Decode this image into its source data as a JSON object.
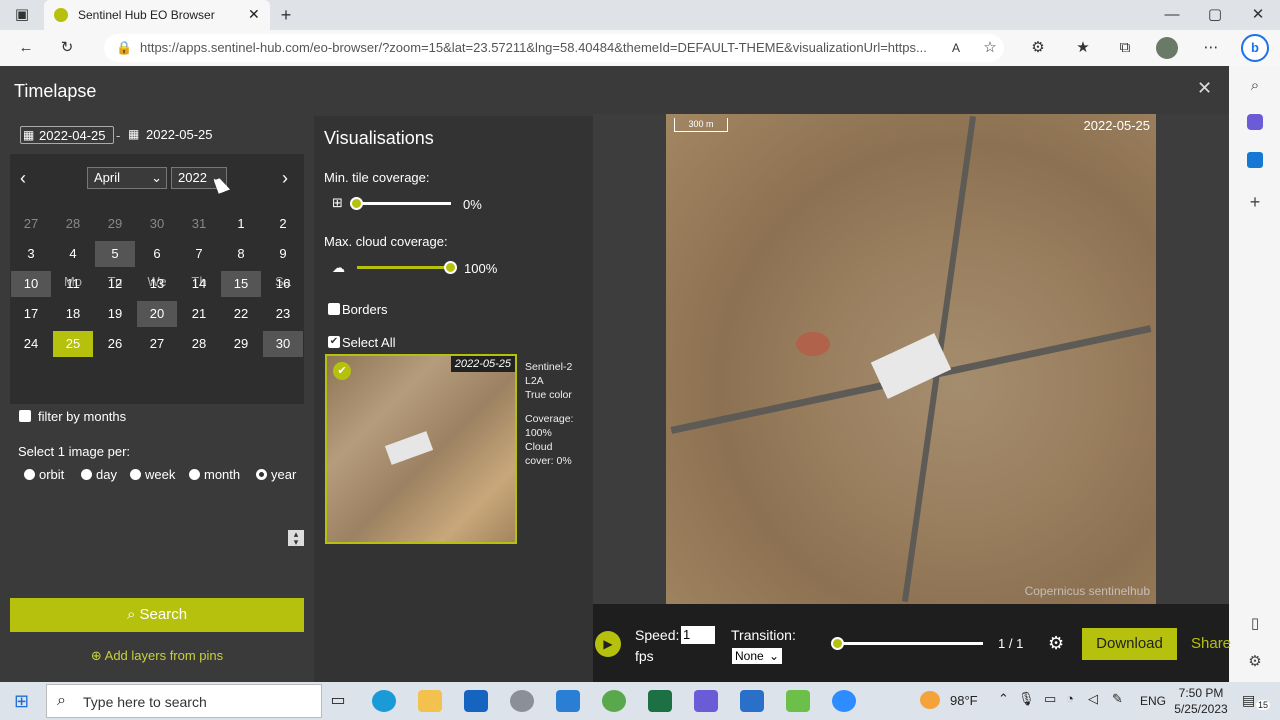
{
  "browser": {
    "tab_title": "Sentinel Hub EO Browser",
    "url": "https://apps.sentinel-hub.com/eo-browser/?zoom=15&lat=23.57211&lng=58.40484&themeId=DEFAULT-THEME&visualizationUrl=https..."
  },
  "panel": {
    "title": "Timelapse",
    "date_from": "2022-04-25",
    "date_sep": "-",
    "date_to": "2022-05-25"
  },
  "calendar": {
    "month": "April",
    "year": "2022",
    "weekdays": [
      "Su",
      "Mo",
      "Tu",
      "We",
      "Th",
      "Fr",
      "Sa"
    ],
    "rows": [
      [
        "27",
        "28",
        "29",
        "30",
        "31",
        "1",
        "2"
      ],
      [
        "3",
        "4",
        "5",
        "6",
        "7",
        "8",
        "9"
      ],
      [
        "10",
        "11",
        "12",
        "13",
        "14",
        "15",
        "16"
      ],
      [
        "17",
        "18",
        "19",
        "20",
        "21",
        "22",
        "23"
      ],
      [
        "24",
        "25",
        "26",
        "27",
        "28",
        "29",
        "30"
      ]
    ]
  },
  "filters": {
    "filter_by_months": "filter by months",
    "select_per_label": "Select 1 image per:",
    "options": [
      "orbit",
      "day",
      "week",
      "month",
      "year"
    ],
    "selected": "year"
  },
  "search_label": "Search",
  "add_layers_label": "Add layers from pins",
  "visualisations": {
    "title": "Visualisations",
    "min_tile_label": "Min. tile coverage:",
    "min_tile_value": "0%",
    "max_cloud_label": "Max. cloud coverage:",
    "max_cloud_value": "100%",
    "borders_label": "Borders",
    "select_all_label": "Select All",
    "thumb": {
      "date": "2022-05-25",
      "info": [
        "Sentinel-2",
        "L2A",
        "True color",
        "",
        "Coverage:",
        "100%",
        "Cloud",
        "cover: 0%"
      ]
    }
  },
  "map": {
    "date": "2022-05-25",
    "scale": "300 m",
    "credit": "Copernicus  sentinelhub"
  },
  "player": {
    "speed_label": "Speed:",
    "speed_value": "1",
    "fps_label": "fps",
    "transition_label": "Transition:",
    "transition_value": "None",
    "counter": "1 / 1",
    "download_label": "Download",
    "share_label": "Share"
  },
  "taskbar": {
    "search_placeholder": "Type here to search",
    "weather": "98°F",
    "lang": "ENG",
    "time": "7:50 PM",
    "date": "5/25/2023",
    "notif_count": "15"
  },
  "colors": {
    "accent": "#b5c10d",
    "panel": "#3a3a3a"
  }
}
